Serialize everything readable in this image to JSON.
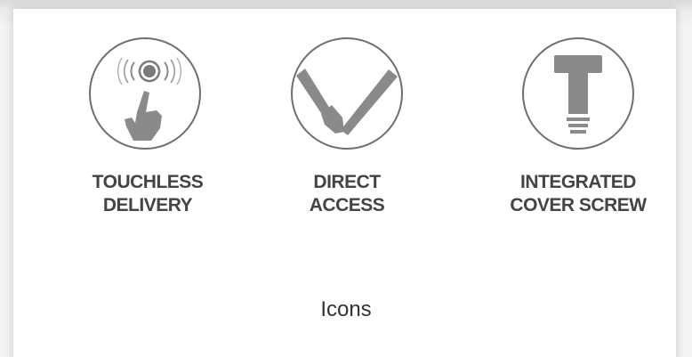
{
  "features": [
    {
      "line1": "TOUCHLESS",
      "line2": "DELIVERY",
      "icon": "touchless-hand-icon"
    },
    {
      "line1": "DIRECT",
      "line2": "ACCESS",
      "icon": "direct-access-checkmark-icon"
    },
    {
      "line1": "INTEGRATED",
      "line2": "COVER SCREW",
      "icon": "cover-screw-icon"
    }
  ],
  "caption": "Icons",
  "colors": {
    "icon_gray": "#8a8a8a",
    "circle_stroke": "#6f6f6f",
    "text": "#444444"
  }
}
